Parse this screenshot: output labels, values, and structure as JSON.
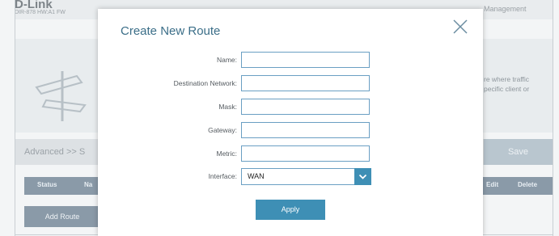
{
  "background": {
    "brand": "D-Link",
    "model": "DIR-878 HW:A1 FW",
    "management_tab": "Management",
    "description_lines": [
      "re where traffic",
      "pecific client or"
    ],
    "breadcrumb": "Advanced >> S",
    "save_label": "Save",
    "table_headers": {
      "status": "Status",
      "name": "Na",
      "edit": "Edit",
      "delete": "Delete"
    },
    "add_route_label": "Add Route"
  },
  "modal": {
    "title": "Create New Route",
    "fields": [
      {
        "label": "Name:",
        "value": ""
      },
      {
        "label": "Destination Network:",
        "value": ""
      },
      {
        "label": "Mask:",
        "value": ""
      },
      {
        "label": "Gateway:",
        "value": ""
      },
      {
        "label": "Metric:",
        "value": ""
      }
    ],
    "interface": {
      "label": "Interface:",
      "value": "WAN"
    },
    "apply_label": "Apply"
  },
  "colors": {
    "accent": "#3e8fb5",
    "title": "#3b6e88",
    "input_border": "#6a9fc3"
  },
  "icons": {
    "close": "close-icon",
    "dropdown": "chevron-down-icon",
    "signpost": "signpost-icon"
  }
}
